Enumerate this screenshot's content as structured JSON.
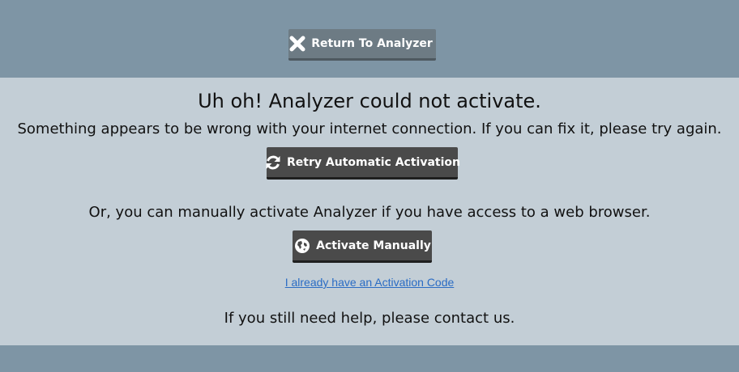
{
  "header": {
    "return_button": {
      "label": "Return To Analyzer",
      "icon": "close-icon"
    }
  },
  "main": {
    "title": "Uh oh! Analyzer could not activate.",
    "connection_message": "Something appears to be wrong with your internet connection. If you can fix it, please try again.",
    "retry_button": {
      "label": "Retry Automatic Activation",
      "icon": "refresh-icon"
    },
    "manual_message": "Or, you can manually activate Analyzer if you have access to a web browser.",
    "manual_button": {
      "label": "Activate Manually",
      "icon": "globe-icon"
    },
    "activation_code_link": "I already have an Activation Code",
    "help_message": "If you still need help, please contact us."
  },
  "colors": {
    "band": "#7e95a5",
    "panel": "#c3ced6",
    "dark_button": "#4a4a4a",
    "return_button": "#6d7b84",
    "link": "#2a6cc4"
  }
}
